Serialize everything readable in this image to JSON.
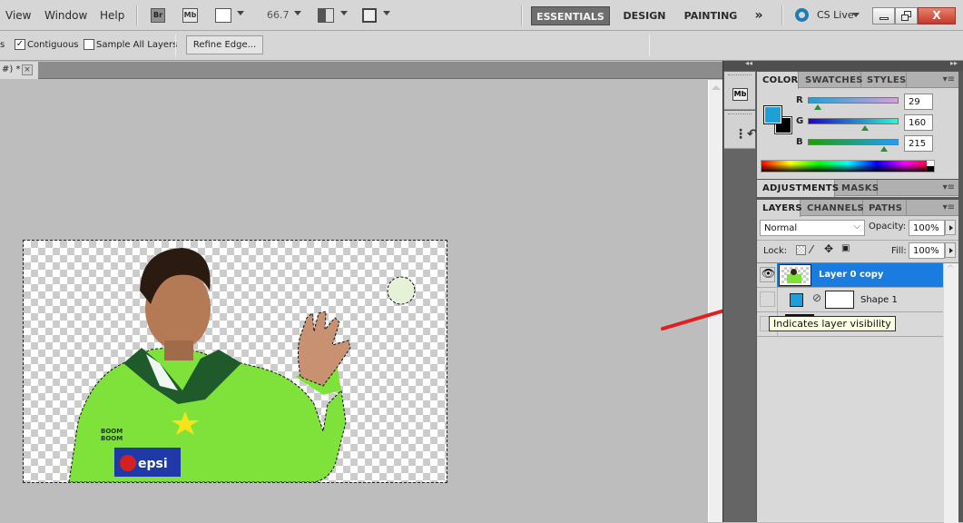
{
  "menubar": {
    "items": [
      "View",
      "Window",
      "Help"
    ],
    "toolbar_icons": [
      {
        "name": "bridge-icon",
        "label": "Br"
      },
      {
        "name": "mini-bridge-icon",
        "label": "Mb"
      },
      {
        "name": "view-extras-icon",
        "label": ""
      },
      {
        "name": "arrange-documents-icon",
        "label": ""
      },
      {
        "name": "screen-mode-icon",
        "label": ""
      }
    ],
    "zoom_level": "66.7",
    "workspaces": [
      "ESSENTIALS",
      "DESIGN",
      "PAINTING"
    ],
    "active_workspace": "ESSENTIALS",
    "more_workspaces": "»",
    "cs_live": "CS Live",
    "window_controls": {
      "minimize": "–",
      "restore": "❐",
      "close": "X"
    }
  },
  "options_bar": {
    "partial_label": "s",
    "contiguous": {
      "label": "Contiguous",
      "checked": true
    },
    "sample_all_layers": {
      "label": "Sample All Layers",
      "checked": false
    },
    "refine_edge": "Refine Edge..."
  },
  "document_tab": {
    "title": "#) *",
    "close": "×"
  },
  "color_panel": {
    "tabs": [
      "COLOR",
      "SWATCHES",
      "STYLES"
    ],
    "active_tab": "COLOR",
    "foreground_color": "#1da0d7",
    "background_color": "#000000",
    "channels": [
      {
        "label": "R",
        "value": "29",
        "fraction": 0.114
      },
      {
        "label": "G",
        "value": "160",
        "fraction": 0.627
      },
      {
        "label": "B",
        "value": "215",
        "fraction": 0.843
      }
    ]
  },
  "adjustments_panel": {
    "tabs": [
      "ADJUSTMENTS",
      "MASKS"
    ],
    "active_tab": "ADJUSTMENTS"
  },
  "layers_panel": {
    "tabs": [
      "LAYERS",
      "CHANNELS",
      "PATHS"
    ],
    "active_tab": "LAYERS",
    "blend_mode": "Normal",
    "opacity_label": "Opacity:",
    "opacity": "100%",
    "lock_label": "Lock:",
    "fill_label": "Fill:",
    "fill": "100%",
    "layers": [
      {
        "name": "Layer 0 copy",
        "visible": true,
        "selected": true
      },
      {
        "name": "Shape 1",
        "visible": false,
        "selected": false
      },
      {
        "name": "",
        "visible": false,
        "selected": false
      }
    ]
  },
  "tooltip": "Indicates layer visibility",
  "annotation": {
    "arrow_color": "#e02020"
  }
}
